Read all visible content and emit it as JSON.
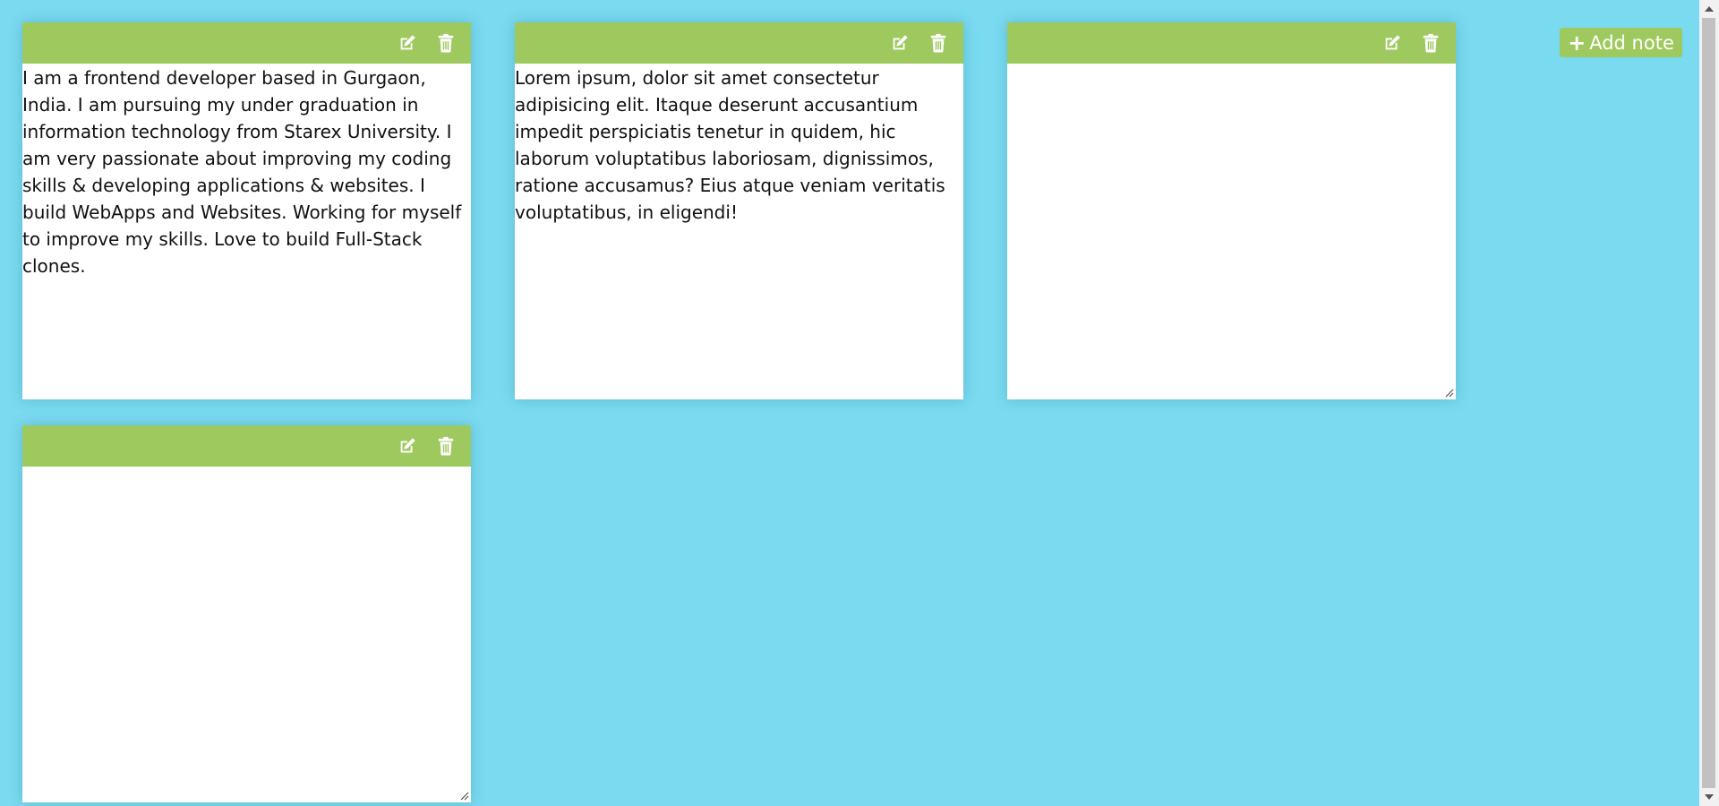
{
  "toolbar_labels": {
    "add_note": "Add note"
  },
  "icons": {
    "edit": "edit-icon",
    "delete": "trash-icon",
    "add": "plus-icon"
  },
  "colors": {
    "background": "#7adaf0",
    "accent": "#9ec95e",
    "note_body": "#ffffff"
  },
  "notes": [
    {
      "text": "I am a frontend developer based in Gurgaon, India. I am pursuing my under graduation in information technology from Starex University. I am very passionate about improving my coding skills & developing applications & websites. I build WebApps and Websites. Working for myself to improve my skills. Love to build Full-Stack clones."
    },
    {
      "text": "Lorem ipsum, dolor sit amet consectetur adipisicing elit. Itaque deserunt accusantium impedit perspiciatis tenetur in quidem, hic laborum voluptatibus laboriosam, dignissimos, ratione accusamus? Eius atque veniam veritatis voluptatibus, in eligendi!"
    },
    {
      "text": ""
    },
    {
      "text": ""
    }
  ]
}
